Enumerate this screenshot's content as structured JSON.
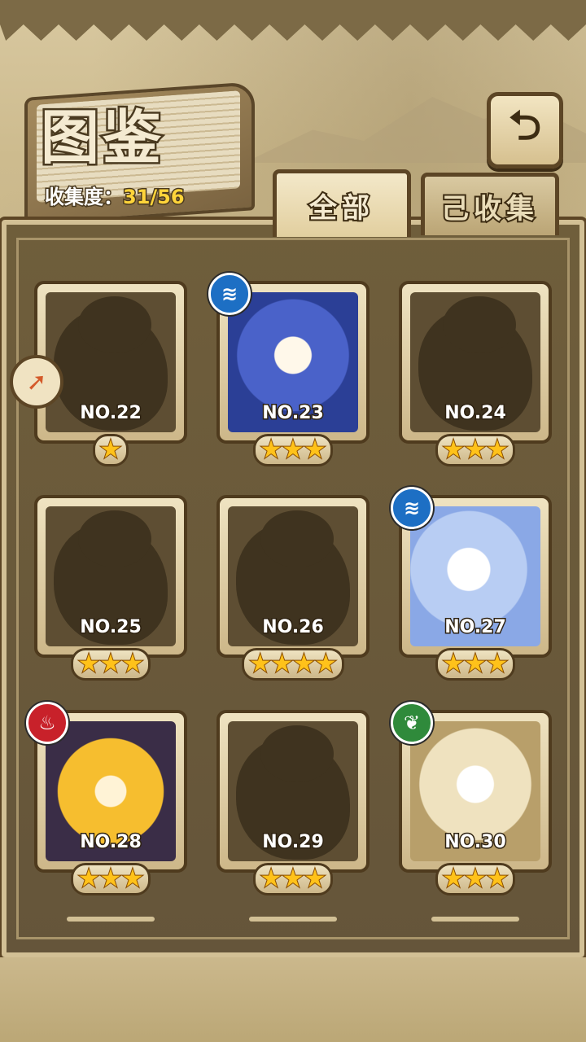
{
  "header": {
    "title": "图鉴",
    "collection_label": "收集度：",
    "collection_value": "31/56",
    "back_icon": "back-arrow-icon"
  },
  "tabs": [
    {
      "label": "全部",
      "active": true
    },
    {
      "label": "己收集",
      "active": false
    }
  ],
  "side_button_icon": "pin-icon",
  "cards": [
    {
      "no": "NO.22",
      "stars": "★",
      "star_count": 1,
      "element": null,
      "collected": false
    },
    {
      "no": "NO.23",
      "stars": "★★★",
      "star_count": 3,
      "element": "water",
      "collected": true
    },
    {
      "no": "NO.24",
      "stars": "★★★",
      "star_count": 3,
      "element": null,
      "collected": false
    },
    {
      "no": "NO.25",
      "stars": "★★★",
      "star_count": 3,
      "element": null,
      "collected": false
    },
    {
      "no": "NO.26",
      "stars": "★★★★",
      "star_count": 4,
      "element": null,
      "collected": false
    },
    {
      "no": "NO.27",
      "stars": "★★★",
      "star_count": 3,
      "element": "water",
      "collected": true
    },
    {
      "no": "NO.28",
      "stars": "★★★",
      "star_count": 3,
      "element": "fire",
      "collected": true
    },
    {
      "no": "NO.29",
      "stars": "★★★",
      "star_count": 3,
      "element": null,
      "collected": false
    },
    {
      "no": "NO.30",
      "stars": "★★★",
      "star_count": 3,
      "element": "wind",
      "collected": true
    }
  ],
  "element_glyphs": {
    "water": "≋",
    "fire": "♨",
    "wind": "❦"
  },
  "colors": {
    "star": "#ffc21a",
    "water": "#1d6fc4",
    "fire": "#c8212a",
    "wind": "#2f8a3b"
  }
}
